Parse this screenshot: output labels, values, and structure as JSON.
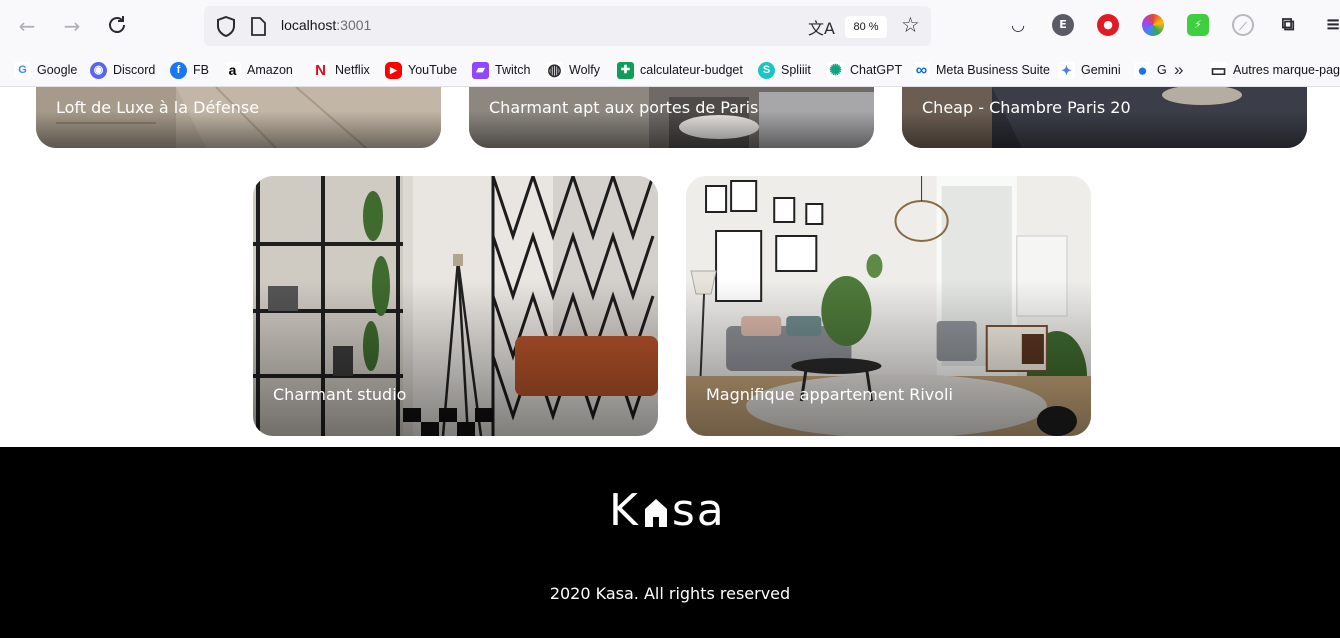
{
  "browser": {
    "url_host": "localhost",
    "url_port": ":3001",
    "zoom": "80 %"
  },
  "bookmarks": [
    {
      "label": "Google",
      "icon": "google-icon",
      "color": "#4285f4",
      "glyph": "G"
    },
    {
      "label": "Discord",
      "icon": "discord-icon",
      "color": "#5865f2",
      "glyph": "◉"
    },
    {
      "label": "FB",
      "icon": "facebook-icon",
      "color": "#1877f2",
      "glyph": "f"
    },
    {
      "label": "Amazon",
      "icon": "amazon-icon",
      "color": "#ffffff",
      "glyph": "a"
    },
    {
      "label": "Netflix",
      "icon": "netflix-icon",
      "color": "#ffffff",
      "glyph": "N"
    },
    {
      "label": "YouTube",
      "icon": "youtube-icon",
      "color": "#ff0000",
      "glyph": "▶"
    },
    {
      "label": "Twitch",
      "icon": "twitch-icon",
      "color": "#9146ff",
      "glyph": "▰"
    },
    {
      "label": "Wolfy",
      "icon": "globe-icon",
      "color": "#ffffff",
      "glyph": "◍"
    },
    {
      "label": "calculateur-budget",
      "icon": "sheets-icon",
      "color": "#0f9d58",
      "glyph": "✚"
    },
    {
      "label": "Spliiit",
      "icon": "spliiit-icon",
      "color": "#18c6c8",
      "glyph": "S"
    },
    {
      "label": "ChatGPT",
      "icon": "chatgpt-icon",
      "color": "#ffffff",
      "glyph": "✺"
    },
    {
      "label": "Meta Business Suite",
      "icon": "meta-icon",
      "color": "#ffffff",
      "glyph": "∞"
    },
    {
      "label": "Gemini",
      "icon": "gemini-icon",
      "color": "#ffffff",
      "glyph": "✦"
    },
    {
      "label": "G",
      "icon": "messages-icon",
      "color": "#1a73e8",
      "glyph": "●"
    },
    {
      "label": "Autres marque-pages",
      "icon": "folder-icon",
      "color": "#ffffff",
      "glyph": "▭"
    }
  ],
  "cards": [
    {
      "title": "Loft de Luxe à la Défense"
    },
    {
      "title": "Charmant apt aux portes de Paris"
    },
    {
      "title": "Cheap - Chambre Paris 20"
    },
    {
      "title": "Charmant studio"
    },
    {
      "title": "Magnifique appartement Rivoli"
    }
  ],
  "footer": {
    "logo_left": "K",
    "logo_right": "sa",
    "copyright": "2020 Kasa. All rights reserved"
  }
}
